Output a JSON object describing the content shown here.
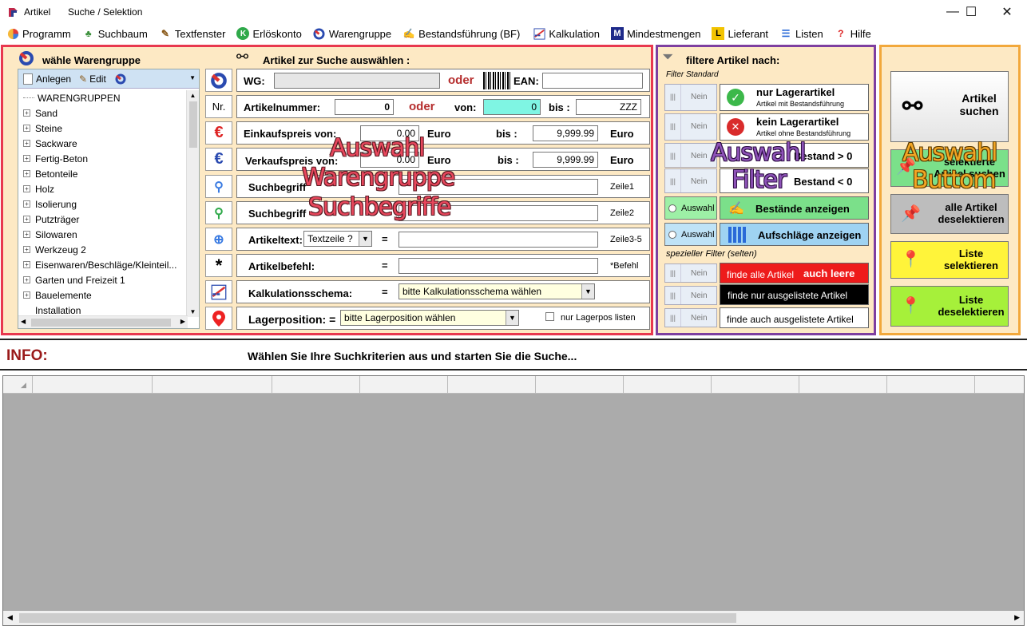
{
  "window": {
    "app_title": "Artikel",
    "subtitle": "Suche / Selektion",
    "minimize": "—",
    "maximize": "☐",
    "close": "✕"
  },
  "menu": [
    {
      "label": "Programm",
      "icon": "program-icon"
    },
    {
      "label": "Suchbaum",
      "icon": "tree-icon"
    },
    {
      "label": "Textfenster",
      "icon": "pencil-icon"
    },
    {
      "label": "Erlöskonto",
      "icon": "k-icon"
    },
    {
      "label": "Warengruppe",
      "icon": "warengruppe-icon"
    },
    {
      "label": "Bestandsführung (BF)",
      "icon": "stock-icon"
    },
    {
      "label": "Kalkulation",
      "icon": "calc-icon"
    },
    {
      "label": "Mindestmengen",
      "icon": "m-icon"
    },
    {
      "label": "Lieferant",
      "icon": "l-icon"
    },
    {
      "label": "Listen",
      "icon": "list-icon"
    },
    {
      "label": "Hilfe",
      "icon": "help-icon"
    }
  ],
  "warengruppe": {
    "title": "wähle Warengruppe",
    "toolbar": {
      "add": "Anlegen",
      "edit": "Edit"
    },
    "tree": [
      "WARENGRUPPEN",
      "Sand",
      "Steine",
      "Sackware",
      "Fertig-Beton",
      "Betonteile",
      "Holz",
      "Isolierung",
      "Putzträger",
      "Silowaren",
      "Werkzeug 2",
      "Eisenwaren/Beschläge/Kleinteil...",
      "Garten und Freizeit 1",
      "Bauelemente",
      "Installation"
    ]
  },
  "search": {
    "title": "Artikel zur Suche auswählen :",
    "nr_button": "Nr.",
    "wg_label": "WG:",
    "oder": "oder",
    "ean_label": "EAN:",
    "artikelnummer_label": "Artikelnummer:",
    "artikelnummer_value": "0",
    "von_label": "von:",
    "von_value": "0",
    "bis_label": "bis :",
    "bis_value": "ZZZ",
    "ek_label": "Einkaufspreis  von:",
    "ek_from": "0.00",
    "ek_to": "9,999.99",
    "vk_label": "Verkaufspreis  von:",
    "vk_from": "0.00",
    "vk_to": "9,999.99",
    "euro": "Euro",
    "bis_short": "bis :",
    "suchbegriff1_label": "Suchbegriff",
    "suchbegriff1_hint": "Zeile1",
    "suchbegriff2_label": "Suchbegriff",
    "suchbegriff2_hint": "Zeile2",
    "artikeltext_label": "Artikeltext:",
    "artikeltext_select": "Textzeile ?",
    "equals": "=",
    "artikeltext_hint": "Zeile3-5",
    "artikelbefehl_label": "Artikelbefehl:",
    "artikelbefehl_hint": "*Befehl",
    "kalk_label": "Kalkulationsschema:",
    "kalk_select": "bitte Kalkulationsschema wählen",
    "lager_label": "Lagerposition: =",
    "lager_select": "bitte Lagerposition wählen",
    "lager_checkbox": "nur Lagerpos listen"
  },
  "filter": {
    "title": "filtere Artikel nach:",
    "standard_label": "Filter  Standard",
    "nein": "Nein",
    "auswahl": "Auswahl",
    "lager_title": "nur Lagerartikel",
    "lager_sub": "Artikel mit Bestandsführung",
    "kein_title": "kein Lagerartikel",
    "kein_sub": "Artikel ohne Bestandsführung",
    "bestand_pos": "Bestand > 0",
    "bestand_neg": "Bestand < 0",
    "bestaende": "Bestände anzeigen",
    "aufschlaege": "Aufschläge anzeigen",
    "special_label": "spezieller Filter (selten)",
    "alle_a": "finde alle Artikel",
    "alle_b": "auch leere",
    "ausgelistet_nur": "finde nur ausgelistete Artikel",
    "ausgelistet_auch": "finde auch ausgelistete Artikel"
  },
  "actions": {
    "suchen": "Artikel suchen",
    "selektierte": "selektierte Artikel suchen",
    "alle_deselekt": "alle Artikel deselektieren",
    "liste_select": "Liste selektieren",
    "liste_deselect": "Liste deselektieren"
  },
  "overlays": {
    "red1": "Auswahl",
    "red2": "Warengruppe",
    "red3": "Suchbegriffe",
    "purple1": "Auswahl",
    "purple2": "Filter",
    "orange1": "Auswahl",
    "orange2": "Buttom"
  },
  "info": {
    "label": "INFO:",
    "text": "Wählen Sie Ihre Suchkriterien aus und starten Sie die Suche..."
  },
  "colors": {
    "band_bg": "#fde9c4",
    "red_border": "#e8384f",
    "purple_border": "#7e3fa0",
    "orange_border": "#f2a83b",
    "von_field": "#7ff5e3",
    "green_btn": "#7be08a",
    "blue_btn": "#9fd3f2",
    "yellow_btn": "#fff43a",
    "lime_btn": "#a6f03a"
  }
}
